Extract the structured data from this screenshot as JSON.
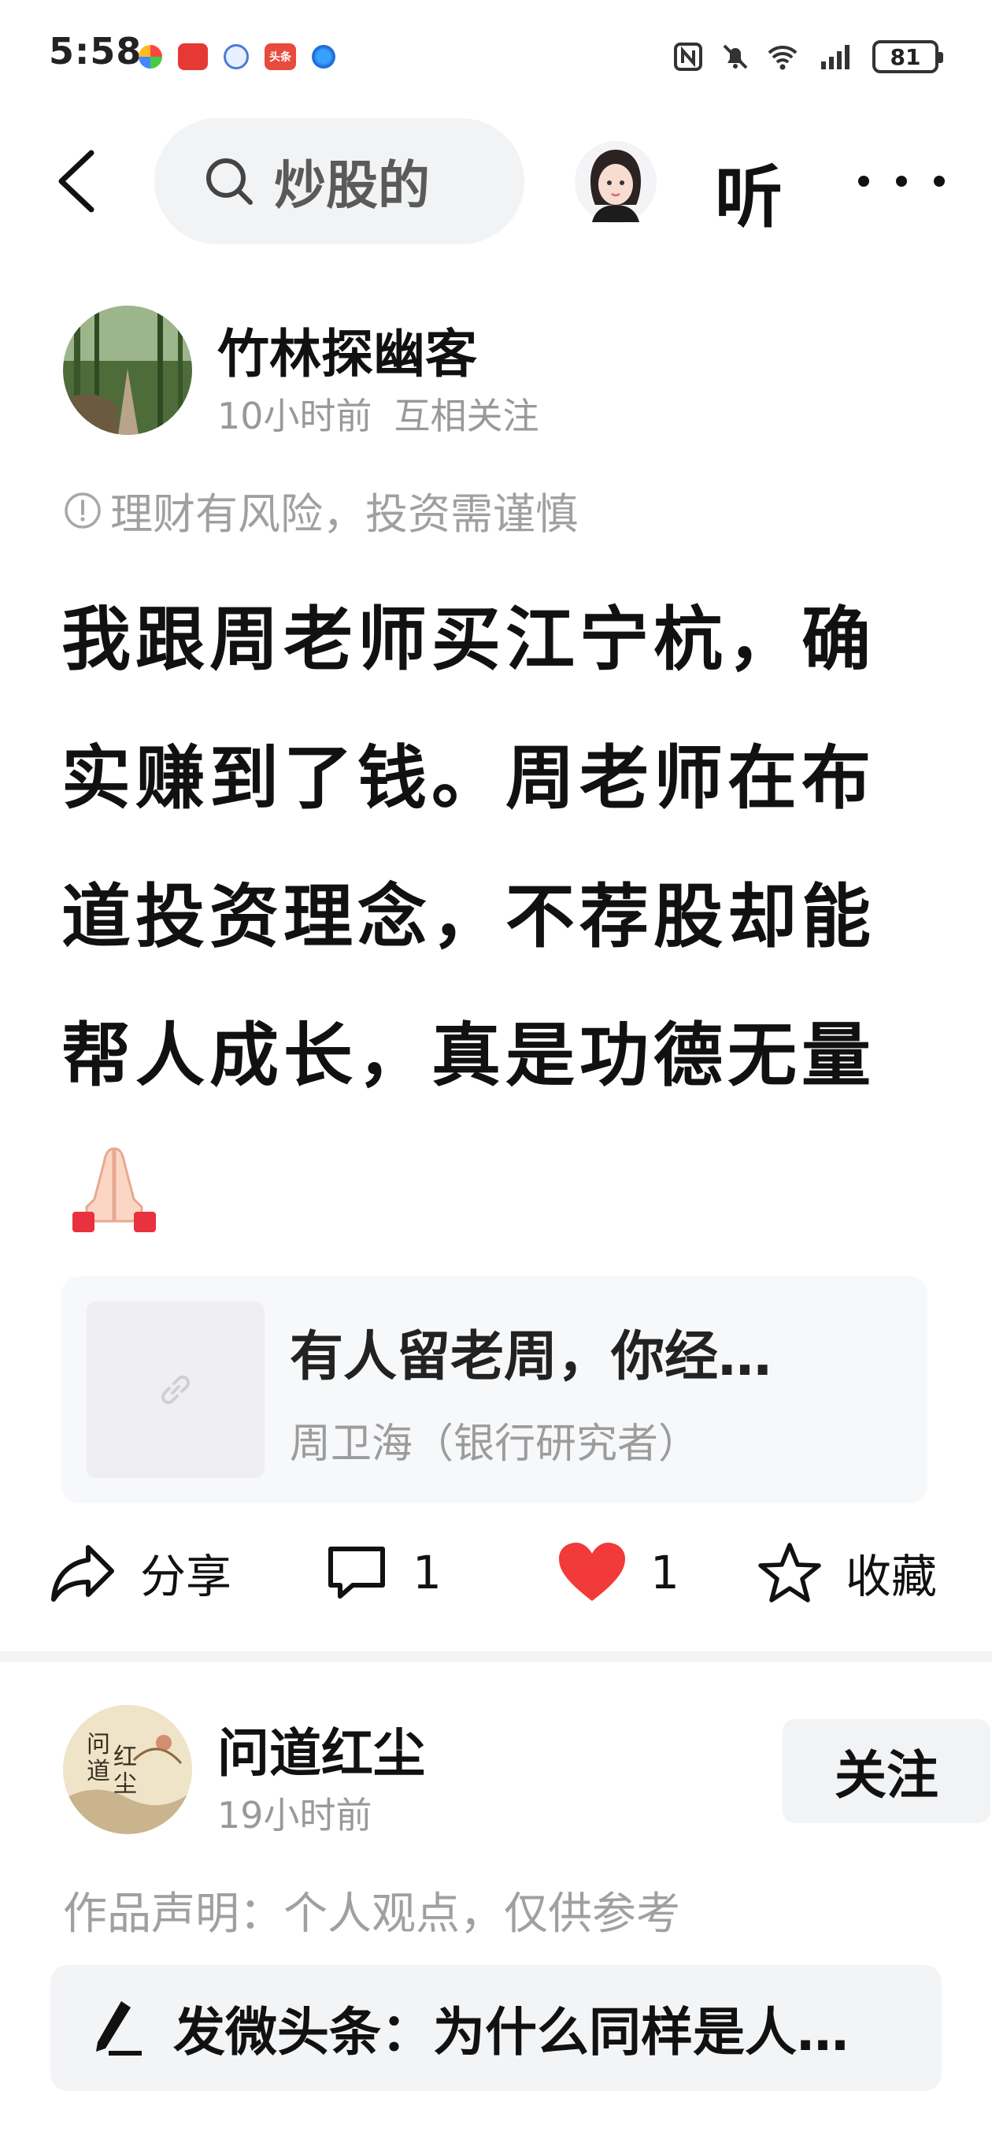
{
  "status_bar": {
    "time": "5:58",
    "battery": "81",
    "app_icons": [
      "app-icon-colorful",
      "app-icon-red-tv",
      "app-icon-blue-circle",
      "app-icon-toutiao",
      "app-icon-browser"
    ],
    "toutiao_label": "头条"
  },
  "nav": {
    "search_text": "炒股的",
    "listen_label": "听"
  },
  "post1": {
    "author": "竹林探幽客",
    "time": "10小时前",
    "relation": "互相关注",
    "risk_note": "理财有风险，投资需谨慎",
    "body": "我跟周老师买江宁杭，确实赚到了钱。周老师在布道投资理念，不荐股却能帮人成长，真是功德无量",
    "emoji": "praying-hands-emoji",
    "link_card": {
      "title": "有人留老周，你经…",
      "source": "周卫海（银行研究者）"
    },
    "actions": {
      "share_label": "分享",
      "comment_count": "1",
      "like_count": "1",
      "favorite_label": "收藏"
    },
    "like_color": "#f23a3a"
  },
  "post2": {
    "author": "问道红尘",
    "time": "19小时前",
    "follow_label": "关注",
    "work_note": "作品声明：个人观点，仅供参考",
    "weitoutiao_text": "发微头条：为什么同样是人…"
  }
}
